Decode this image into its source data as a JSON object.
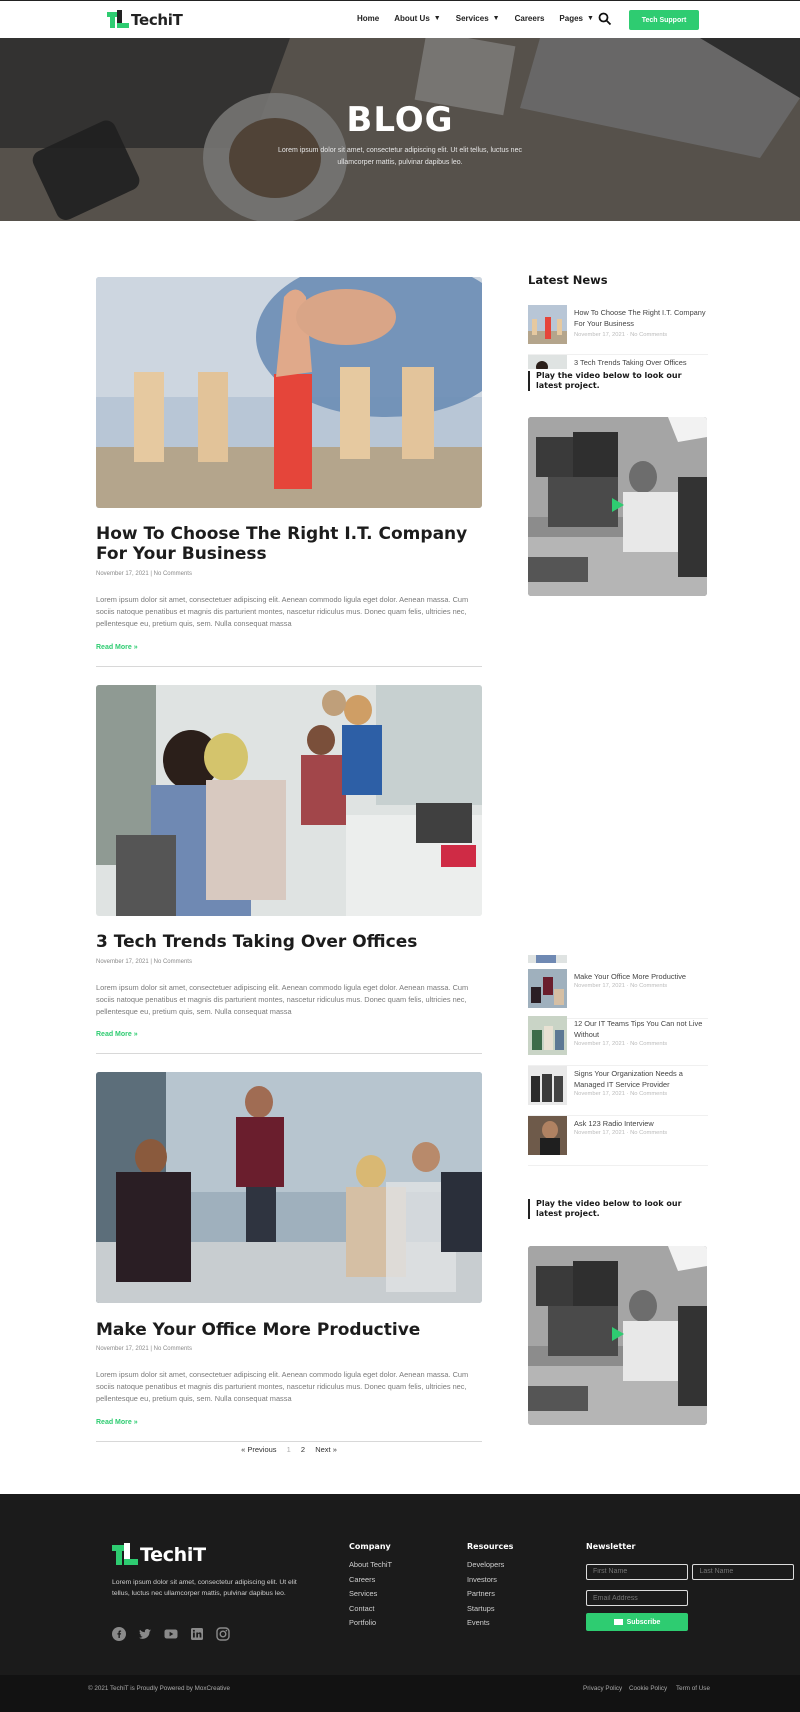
{
  "header": {
    "logo_text": "TechiT",
    "nav": [
      {
        "label": "Home",
        "dropdown": false
      },
      {
        "label": "About Us",
        "dropdown": true
      },
      {
        "label": "Services",
        "dropdown": true
      },
      {
        "label": "Careers",
        "dropdown": false
      },
      {
        "label": "Pages",
        "dropdown": true
      }
    ],
    "search_icon": "search-icon",
    "cta_label": "Tech Support"
  },
  "hero": {
    "title": "BLOG",
    "subtitle": "Lorem ipsum dolor sit amet, consectetur adipiscing elit. Ut elit tellus, luctus nec ullamcorper mattis, pulvinar dapibus leo."
  },
  "posts": [
    {
      "title": "How To Choose The Right I.T. Company For Your Business",
      "date": "November 17, 2021",
      "comments": "No Comments",
      "excerpt": "Lorem ipsum dolor sit amet, consectetuer adipiscing elit. Aenean commodo ligula eget dolor. Aenean massa. Cum sociis natoque penatibus et magnis dis parturient montes, nascetur ridiculus mus. Donec quam felis, ultricies nec, pellentesque eu, pretium quis, sem. Nulla consequat massa",
      "read_more": "Read More »"
    },
    {
      "title": "3 Tech Trends Taking Over Offices",
      "date": "November 17, 2021",
      "comments": "No Comments",
      "excerpt": "Lorem ipsum dolor sit amet, consectetuer adipiscing elit. Aenean commodo ligula eget dolor. Aenean massa. Cum sociis natoque penatibus et magnis dis parturient montes, nascetur ridiculus mus. Donec quam felis, ultricies nec, pellentesque eu, pretium quis, sem. Nulla consequat massa",
      "read_more": "Read More »"
    },
    {
      "title": "Make Your Office More Productive",
      "date": "November 17, 2021",
      "comments": "No Comments",
      "excerpt": "Lorem ipsum dolor sit amet, consectetuer adipiscing elit. Aenean commodo ligula eget dolor. Aenean massa. Cum sociis natoque penatibus et magnis dis parturient montes, nascetur ridiculus mus. Donec quam felis, ultricies nec, pellentesque eu, pretium quis, sem. Nulla consequat massa",
      "read_more": "Read More »"
    }
  ],
  "pagination": {
    "previous": "« Previous",
    "pages": [
      "1",
      "2"
    ],
    "current": "1",
    "next": "Next »"
  },
  "sidebar": {
    "heading": "Latest News",
    "news_top": [
      {
        "title": "How To Choose The Right I.T. Company For Your Business",
        "date": "November 17, 2021",
        "comments": "No Comments"
      },
      {
        "title": "3 Tech Trends Taking Over Offices",
        "date": "",
        "comments": ""
      }
    ],
    "news_bottom": [
      {
        "title": "Make Your Office More Productive",
        "date": "November 17, 2021",
        "comments": "No Comments"
      },
      {
        "title": "12 Our IT Teams Tips You Can not Live Without",
        "date": "November 17, 2021",
        "comments": "No Comments"
      },
      {
        "title": "Signs Your Organization Needs a Managed IT Service Provider",
        "date": "November 17, 2021",
        "comments": "No Comments"
      },
      {
        "title": "Ask 123 Radio Interview",
        "date": "November 17, 2021",
        "comments": "No Comments"
      }
    ],
    "video_note": "Play the video below to look our latest project.",
    "play_icon": "play-icon"
  },
  "footer": {
    "logo_text": "TechiT",
    "about": "Lorem ipsum dolor sit amet, consectetur adipiscing elit. Ut elit tellus, luctus nec ullamcorper mattis, pulvinar dapibus leo.",
    "socials": [
      "facebook-icon",
      "twitter-icon",
      "youtube-icon",
      "linkedin-icon",
      "instagram-icon"
    ],
    "company": {
      "heading": "Company",
      "links": [
        "About TechiT",
        "Careers",
        "Services",
        "Contact",
        "Portfolio"
      ]
    },
    "resources": {
      "heading": "Resources",
      "links": [
        "Developers",
        "Investors",
        "Partners",
        "Startups",
        "Events"
      ]
    },
    "newsletter": {
      "heading": "Newsletter",
      "first_name_placeholder": "First Name",
      "last_name_placeholder": "Last Name",
      "email_placeholder": "Email Address",
      "button_label": "Subscribe"
    },
    "copyright": "© 2021 TechiT is Proudly Powered by MoxCreative",
    "legal": [
      "Privacy Policy",
      "Cookie Policy",
      "Term of Use"
    ]
  },
  "colors": {
    "accent": "#2ecc71",
    "footer_bg": "#1b1b1b",
    "text_dark": "#1c1c1c"
  }
}
